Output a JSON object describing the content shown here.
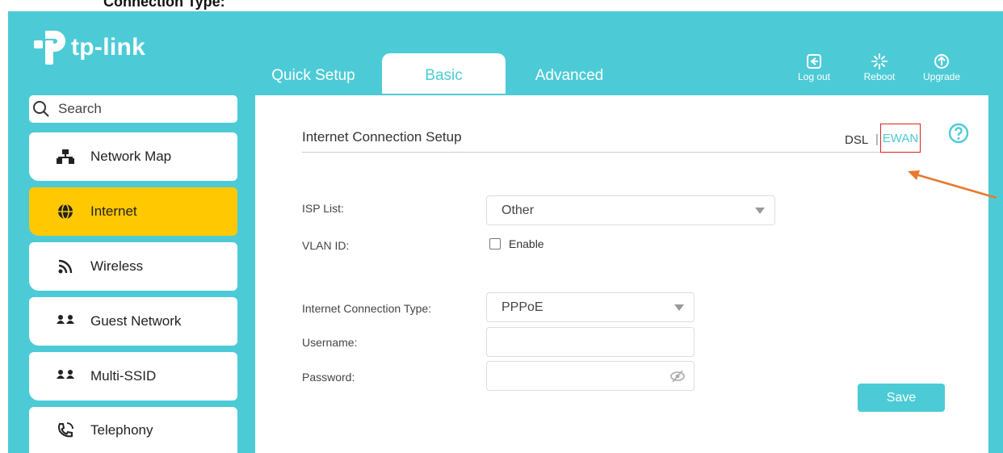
{
  "caption": {
    "text": "Connection Type:"
  },
  "header": {
    "logo_text": "tp-link",
    "tabs": [
      {
        "label": "Quick Setup"
      },
      {
        "label": "Basic"
      },
      {
        "label": "Advanced"
      }
    ],
    "tools": [
      {
        "label": "Log out",
        "icon": "logout-icon"
      },
      {
        "label": "Reboot",
        "icon": "reboot-icon"
      },
      {
        "label": "Upgrade",
        "icon": "upgrade-icon"
      }
    ]
  },
  "sidebar": {
    "search_placeholder": "Search",
    "items": [
      {
        "label": "Network Map",
        "icon": "network-map-icon"
      },
      {
        "label": "Internet",
        "icon": "globe-icon",
        "active": true
      },
      {
        "label": "Wireless",
        "icon": "wireless-icon"
      },
      {
        "label": "Guest Network",
        "icon": "guest-network-icon"
      },
      {
        "label": "Multi-SSID",
        "icon": "multi-ssid-icon"
      },
      {
        "label": "Telephony",
        "icon": "telephony-icon"
      }
    ]
  },
  "main": {
    "section_title": "Internet Connection Setup",
    "mode_dsl": "DSL",
    "mode_separator": "|",
    "mode_ewan": "EWAN",
    "isp_label": "ISP List:",
    "isp_value": "Other",
    "vlan_label": "VLAN ID:",
    "vlan_enable_label": "Enable",
    "vlan_enabled": false,
    "conn_type_label": "Internet Connection Type:",
    "conn_type_value": "PPPoE",
    "username_label": "Username:",
    "username_value": "",
    "password_label": "Password:",
    "password_value": "",
    "save_label": "Save"
  },
  "colors": {
    "brand_teal": "#4ccbd6",
    "active_nav": "#ffc800",
    "highlight_box": "#e02020",
    "annotation_arrow": "#e8792e"
  }
}
